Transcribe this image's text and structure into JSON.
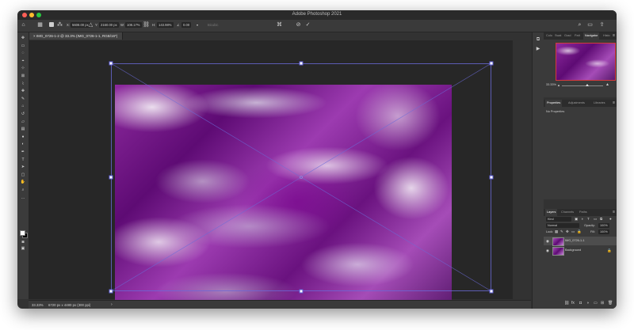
{
  "window": {
    "title": "Adobe Photoshop 2021"
  },
  "options_bar": {
    "x_label": "X:",
    "x_value": "5608.00 px",
    "y_label": "Y:",
    "y_value": "2160.00 px",
    "w_label": "W:",
    "w_value": "108.17%",
    "h_label": "H:",
    "h_value": "143.98%",
    "angle_label": "∠",
    "angle_value": "0.00",
    "interpolation": "Bicubic",
    "cancel_icon": "cancel-transform-icon",
    "commit_icon": "commit-checkmark-icon"
  },
  "document": {
    "tab_title": "IMG_0726-1-2 @ 33.3% (IMG_0726-1-1, RGB/16*)"
  },
  "status_bar": {
    "zoom": "33.33%",
    "doc_info": "6720 px x 4480 px (300 ppi)",
    "arrow": "›"
  },
  "tools": [
    {
      "name": "move-tool-icon",
      "glyph": "✥"
    },
    {
      "name": "artboard-tool-icon",
      "glyph": "▭"
    },
    {
      "name": "lasso-tool-icon",
      "glyph": "◌"
    },
    {
      "name": "magic-wand-tool-icon",
      "glyph": "⌖"
    },
    {
      "name": "crop-tool-icon",
      "glyph": "⊹"
    },
    {
      "name": "frame-tool-icon",
      "glyph": "⊠"
    },
    {
      "name": "eyedropper-tool-icon",
      "glyph": "⌇"
    },
    {
      "name": "healing-brush-tool-icon",
      "glyph": "✚"
    },
    {
      "name": "brush-tool-icon",
      "glyph": "✎"
    },
    {
      "name": "clone-stamp-tool-icon",
      "glyph": "⌂"
    },
    {
      "name": "history-brush-tool-icon",
      "glyph": "↺"
    },
    {
      "name": "eraser-tool-icon",
      "glyph": "▱"
    },
    {
      "name": "gradient-tool-icon",
      "glyph": "▤"
    },
    {
      "name": "blur-tool-icon",
      "glyph": "●"
    },
    {
      "name": "dodge-tool-icon",
      "glyph": "◐"
    },
    {
      "name": "pen-tool-icon",
      "glyph": "✒"
    },
    {
      "name": "type-tool-icon",
      "glyph": "T"
    },
    {
      "name": "path-selection-tool-icon",
      "glyph": "➤"
    },
    {
      "name": "rectangle-tool-icon",
      "glyph": "▢"
    },
    {
      "name": "hand-tool-icon",
      "glyph": "✋"
    },
    {
      "name": "zoom-tool-icon",
      "glyph": "⌕"
    },
    {
      "name": "more-tools-icon",
      "glyph": "…"
    }
  ],
  "panels": {
    "top_tabs": [
      "Colo",
      "Swat",
      "Grad",
      "Patt",
      "Navigator",
      "Histo"
    ],
    "navigator": {
      "zoom": "33.33%"
    },
    "properties": {
      "tabs": [
        "Properties",
        "Adjustments",
        "Libraries"
      ],
      "text": "No Properties"
    },
    "layers": {
      "tabs": [
        "Layers",
        "Channels",
        "Paths"
      ],
      "kind_label": "Kind",
      "blend_mode": "Normal",
      "opacity_label": "Opacity:",
      "opacity_value": "100%",
      "lock_label": "Lock:",
      "fill_label": "Fill:",
      "fill_value": "100%",
      "items": [
        {
          "name": "IMG_0726-1-1",
          "selected": true
        },
        {
          "name": "Background",
          "selected": false
        }
      ]
    }
  }
}
